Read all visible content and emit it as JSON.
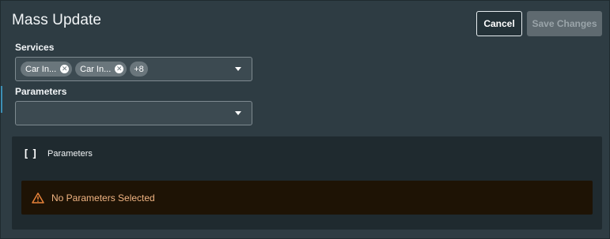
{
  "dialog": {
    "title": "Mass Update",
    "cancel_label": "Cancel",
    "save_label": "Save Changes"
  },
  "services": {
    "label": "Services",
    "chips": [
      {
        "label": "Car In..."
      },
      {
        "label": "Car In..."
      }
    ],
    "more_count": "+8"
  },
  "parameters": {
    "label": "Parameters",
    "value": ""
  },
  "panel": {
    "icon": "bracket-icon",
    "title": "Parameters",
    "alert_text": "No Parameters Selected",
    "alert_icon": "warning-icon"
  },
  "colors": {
    "background": "#2e3c43",
    "panel": "#1f2a2f",
    "alert_bg": "#1e1305",
    "alert_text": "#f0b482",
    "accent": "#3c8fb5"
  }
}
